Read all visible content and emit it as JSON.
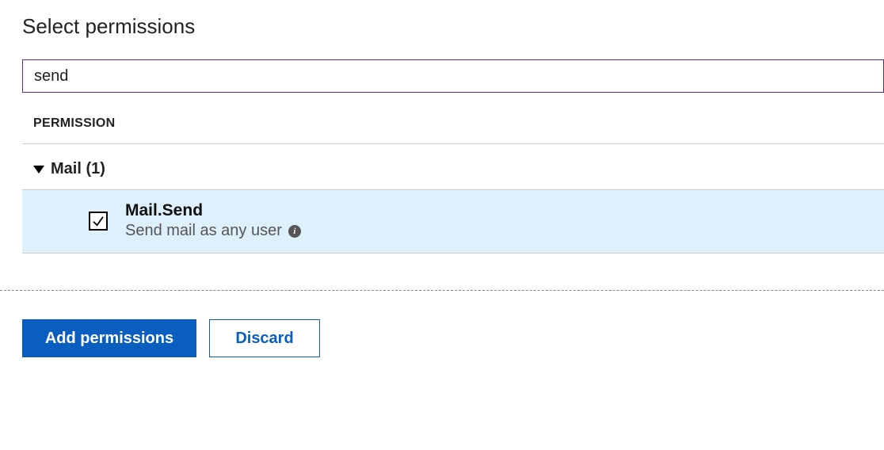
{
  "header": {
    "title": "Select permissions"
  },
  "search": {
    "value": "send"
  },
  "columns": {
    "permission": "Permission"
  },
  "groups": [
    {
      "label": "Mail (1)",
      "expanded": true,
      "items": [
        {
          "name": "Mail.Send",
          "description": "Send mail as any user",
          "checked": true
        }
      ]
    }
  ],
  "footer": {
    "primary": "Add permissions",
    "secondary": "Discard"
  }
}
